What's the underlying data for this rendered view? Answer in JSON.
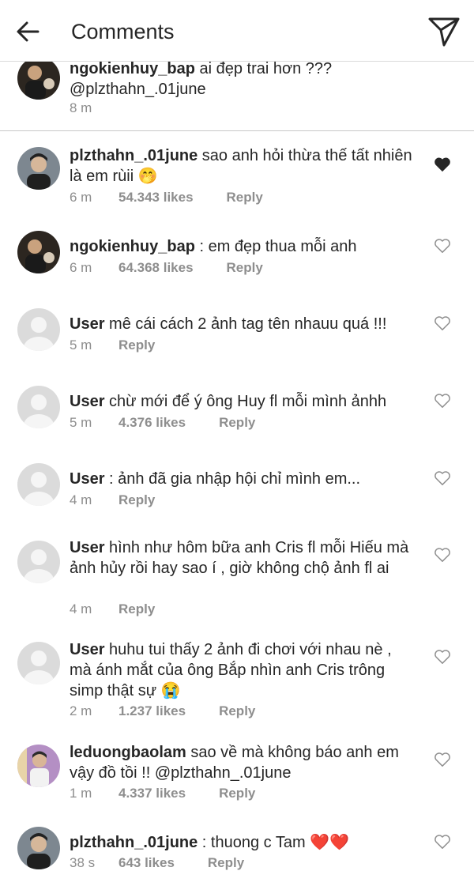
{
  "header": {
    "title": "Comments",
    "back_icon": "back-arrow-icon",
    "send_icon": "send-icon"
  },
  "colors": {
    "text": "#262626",
    "meta": "#8e8e8e",
    "heart_filled": "#262626",
    "divider": "#dbdbdb"
  },
  "comments": [
    {
      "user": "ngokienhuy_bap",
      "text": " ai đẹp trai hơn ???\n@plzthahn_.01june",
      "time": "8 m",
      "likes": "",
      "reply": "",
      "liked": false,
      "avatar": "photo"
    },
    {
      "user": "plzthahn_.01june",
      "text": " sao anh hỏi thừa thế tất nhiên là em rùii 🤭",
      "time": "6 m",
      "likes": "54.343 likes",
      "reply": "Reply",
      "liked": true,
      "avatar": "photo"
    },
    {
      "user": "ngokienhuy_bap",
      "text": " : em đẹp thua mỗi anh",
      "time": "6 m",
      "likes": "64.368 likes",
      "reply": "Reply",
      "liked": false,
      "avatar": "photo"
    },
    {
      "user": "User",
      "text": " mê cái cách 2 ảnh tag tên nhauu quá !!!",
      "time": "5 m",
      "likes": "",
      "reply": "Reply",
      "liked": false,
      "avatar": "default"
    },
    {
      "user": "User",
      "text": " chừ mới để ý ông Huy fl mỗi mình ảnhh",
      "time": "5 m",
      "likes": "4.376 likes",
      "reply": "Reply",
      "liked": false,
      "avatar": "default"
    },
    {
      "user": "User",
      "text": " : ảnh đã gia nhập hội chỉ mình em...",
      "time": "4 m",
      "likes": "",
      "reply": "Reply",
      "liked": false,
      "avatar": "default"
    },
    {
      "user": "User",
      "text": " hình như hôm bữa anh Cris fl mỗi Hiếu mà ảnh hủy rồi hay sao í , giờ không chộ ảnh fl ai",
      "time": "4 m",
      "likes": "",
      "reply": "Reply",
      "liked": false,
      "avatar": "default"
    },
    {
      "user": "User",
      "text": " huhu tui thấy 2 ảnh đi chơi với nhau nè , mà ánh mắt của ông Bắp nhìn anh Cris trông simp thật sự 😭",
      "time": "2 m",
      "likes": "1.237 likes",
      "reply": "Reply",
      "liked": false,
      "avatar": "default"
    },
    {
      "user": "leduongbaolam",
      "text": " sao về mà không báo anh em vậy đồ tồi !! @plzthahn_.01june",
      "time": "1 m",
      "likes": "4.337 likes",
      "reply": "Reply",
      "liked": false,
      "avatar": "photo"
    },
    {
      "user": "plzthahn_.01june",
      "text": " : thuong c Tam ❤️❤️",
      "time": "38 s",
      "likes": "643 likes",
      "reply": "Reply",
      "liked": false,
      "avatar": "photo"
    }
  ]
}
